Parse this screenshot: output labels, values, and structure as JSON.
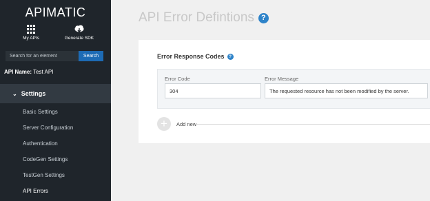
{
  "sidebar": {
    "brand": "APIMATIC",
    "actions": {
      "my_apis": "My APIs",
      "generate_sdk": "Generate SDK"
    },
    "search": {
      "placeholder": "Search for an element",
      "button_label": "Search"
    },
    "api_name_label": "API Name:",
    "api_name_value": "Test API",
    "section": {
      "label": "Settings",
      "items": [
        {
          "label": "Basic Settings"
        },
        {
          "label": "Server Configuration"
        },
        {
          "label": "Authentication"
        },
        {
          "label": "CodeGen Settings"
        },
        {
          "label": "TestGen Settings"
        },
        {
          "label": "API Errors"
        }
      ]
    }
  },
  "main": {
    "title": "API Error Defintions",
    "card": {
      "title": "Error Response Codes",
      "columns": {
        "code": "Error Code",
        "message": "Error Message"
      },
      "row": {
        "code": "304",
        "message": "The requested resource has not been modified by the server."
      },
      "add_label": "Add new"
    }
  },
  "colors": {
    "sidebar_bg": "#1f252b",
    "section_bg": "#323a42",
    "accent": "#1d6bb5",
    "help_icon": "#2e83c9"
  },
  "icons": [
    "grid-icon",
    "cloud-download-icon",
    "chevron-down-icon",
    "help-icon",
    "plus-icon"
  ]
}
